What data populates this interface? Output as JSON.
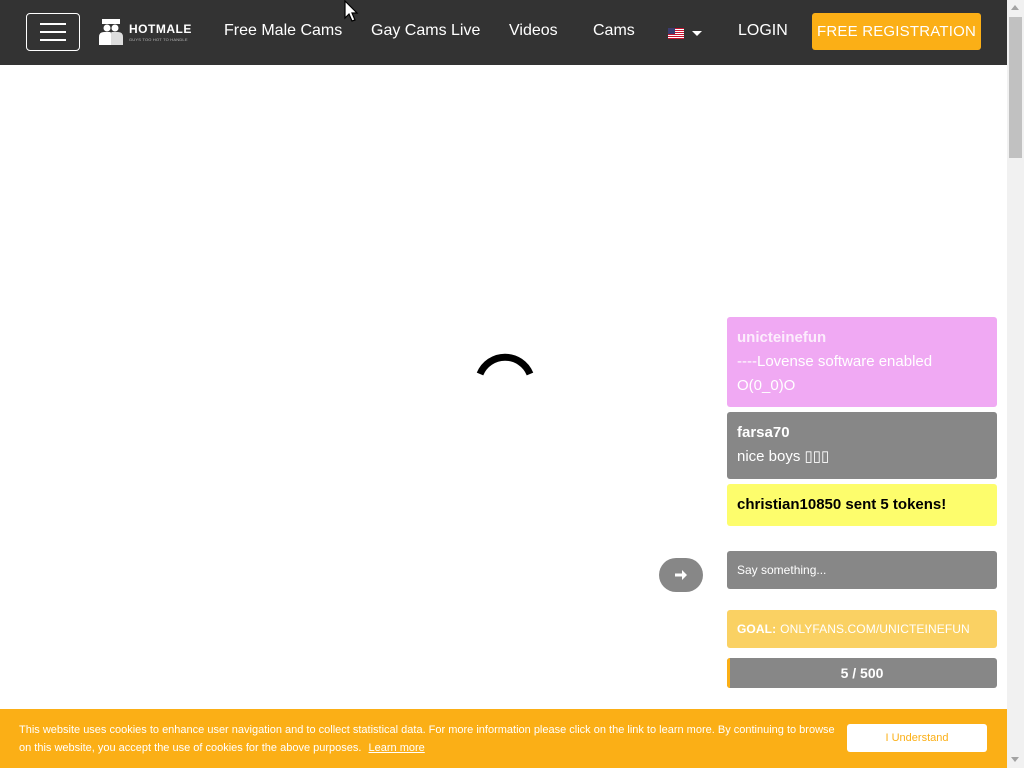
{
  "navbar": {
    "logo_name": "HOTMALE",
    "logo_tagline": "GUYS TOO HOT TO HANDLE",
    "links": [
      "Free Male Cams",
      "Gay Cams Live",
      "Videos",
      "Cams"
    ],
    "language_icon": "us-flag-icon",
    "login_label": "LOGIN",
    "register_label": "FREE REGISTRATION"
  },
  "chat": {
    "messages": [
      {
        "user": "unicteinefun",
        "text": "----Lovense software enabled O(0_0)O",
        "color": "#f0a9f3"
      },
      {
        "user": "farsa70",
        "text": "nice boys ▯▯▯",
        "color": "#878787"
      },
      {
        "user": "christian10850 sent 5 tokens!",
        "text": "",
        "color": "#fdfd6c"
      }
    ],
    "input_placeholder": "Say something...",
    "send_icon": "arrow-right-icon",
    "goal_label": "GOAL:",
    "goal_text": "ONLYFANS.COM/UNICTEINEFUN",
    "progress_current": 5,
    "progress_total": 500,
    "progress_text": "5 / 500"
  },
  "cookie": {
    "text": "This website uses cookies to enhance user navigation and to collect statistical data. For more information please click on the link to learn more. By continuing to browse on this website, you accept the use of cookies for the above purposes.",
    "learn_more": "Learn more",
    "button_label": "I Understand"
  },
  "colors": {
    "navbar_bg": "#333333",
    "accent": "#fbaf16",
    "chat_gray": "#878787",
    "goal_bg": "#fad163"
  }
}
